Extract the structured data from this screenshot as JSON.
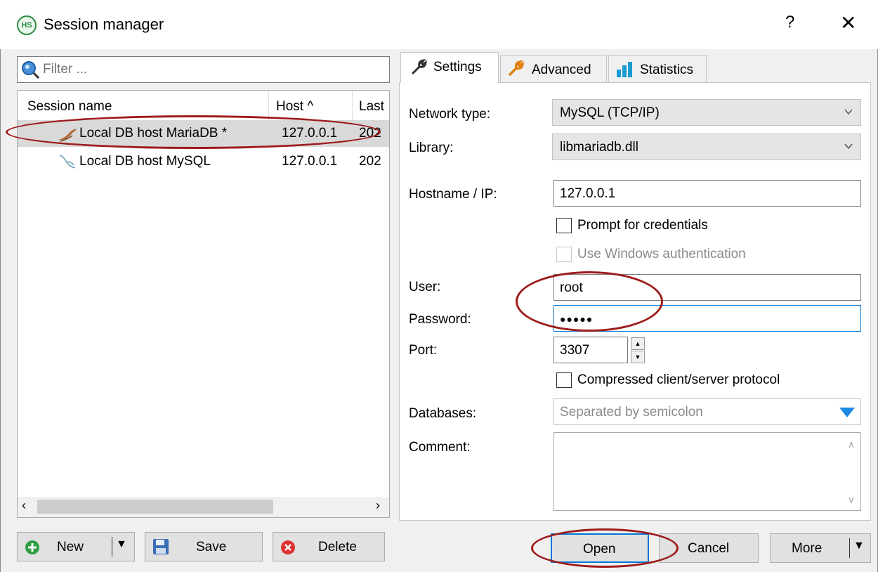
{
  "window": {
    "title": "Session manager",
    "help": "?",
    "close": "✕",
    "app_icon_text": "HS"
  },
  "filter": {
    "placeholder": "Filter ..."
  },
  "sessions": {
    "columns": [
      "Session name",
      "Host ^",
      "Last"
    ],
    "rows": [
      {
        "name": "Local DB host MariaDB *",
        "host": "127.0.0.1",
        "last": "202",
        "selected": true,
        "icon": "mariadb-seal-icon"
      },
      {
        "name": "Local DB host MySQL",
        "host": "127.0.0.1",
        "last": "202",
        "selected": false,
        "icon": "mysql-dolphin-icon"
      }
    ]
  },
  "tabs": [
    {
      "label": "Settings",
      "icon": "wrench-icon",
      "active": true
    },
    {
      "label": "Advanced",
      "icon": "wrench-orange-icon",
      "active": false
    },
    {
      "label": "Statistics",
      "icon": "bar-chart-icon",
      "active": false
    }
  ],
  "settings": {
    "network_type": {
      "label": "Network type:",
      "value": "MySQL (TCP/IP)"
    },
    "library": {
      "label": "Library:",
      "value": "libmariadb.dll"
    },
    "hostname": {
      "label": "Hostname / IP:",
      "value": "127.0.0.1"
    },
    "prompt_credentials": {
      "label": "Prompt for credentials",
      "checked": false
    },
    "windows_auth": {
      "label": "Use Windows authentication",
      "checked": false,
      "enabled": false
    },
    "user": {
      "label": "User:",
      "value": "root"
    },
    "password": {
      "label": "Password:",
      "value": "●●●●●"
    },
    "port": {
      "label": "Port:",
      "value": "3307"
    },
    "compressed": {
      "label": "Compressed client/server protocol",
      "checked": false
    },
    "databases": {
      "label": "Databases:",
      "placeholder": "Separated by semicolon"
    },
    "comment": {
      "label": "Comment:",
      "value": ""
    }
  },
  "buttons": {
    "new": "New",
    "save": "Save",
    "delete": "Delete",
    "open": "Open",
    "cancel": "Cancel",
    "more": "More"
  },
  "colors": {
    "accent": "#0078d7",
    "annotation": "#9e1b1b",
    "selection": "#d9d9d9"
  }
}
